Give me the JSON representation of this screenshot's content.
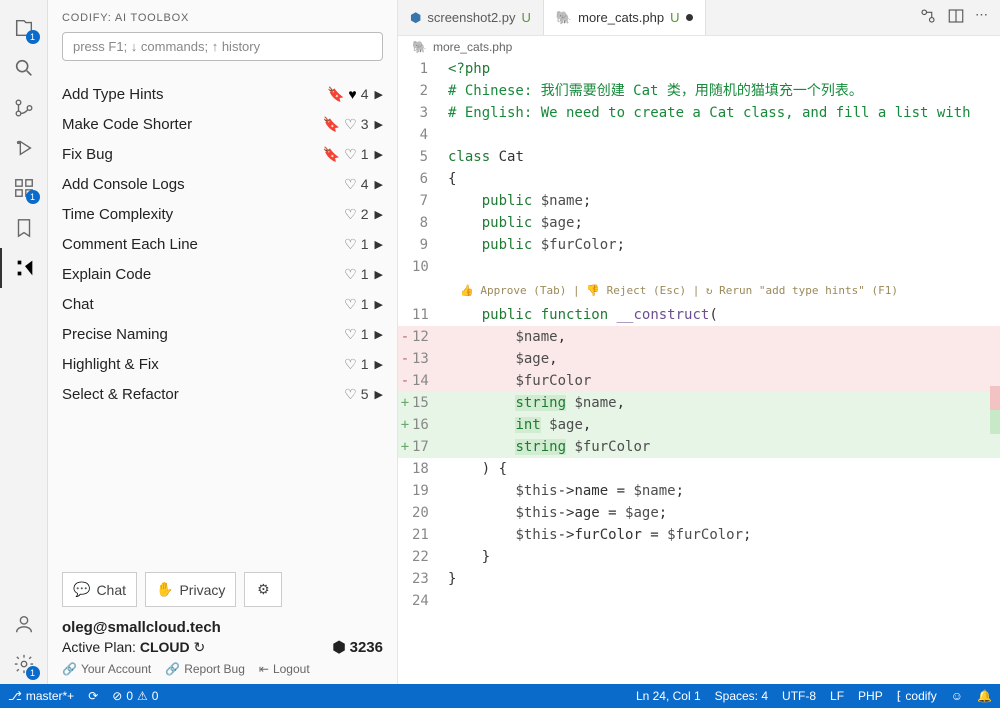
{
  "panel": {
    "title": "CODIFY: AI TOOLBOX",
    "cmd_placeholder": "press F1; ↓ commands; ↑ history"
  },
  "tools": [
    {
      "label": "Add Type Hints",
      "bookmark": true,
      "heart_filled": true,
      "count": 4
    },
    {
      "label": "Make Code Shorter",
      "bookmark": true,
      "heart_filled": false,
      "count": 3
    },
    {
      "label": "Fix Bug",
      "bookmark": true,
      "heart_filled": false,
      "count": 1
    },
    {
      "label": "Add Console Logs",
      "bookmark": false,
      "heart_filled": false,
      "count": 4
    },
    {
      "label": "Time Complexity",
      "bookmark": false,
      "heart_filled": false,
      "count": 2
    },
    {
      "label": "Comment Each Line",
      "bookmark": false,
      "heart_filled": false,
      "count": 1
    },
    {
      "label": "Explain Code",
      "bookmark": false,
      "heart_filled": false,
      "count": 1
    },
    {
      "label": "Chat",
      "bookmark": false,
      "heart_filled": false,
      "count": 1
    },
    {
      "label": "Precise Naming",
      "bookmark": false,
      "heart_filled": false,
      "count": 1
    },
    {
      "label": "Highlight & Fix",
      "bookmark": false,
      "heart_filled": false,
      "count": 1
    },
    {
      "label": "Select & Refactor",
      "bookmark": false,
      "heart_filled": false,
      "count": 5
    }
  ],
  "buttons": {
    "chat": "Chat",
    "privacy": "Privacy"
  },
  "account": {
    "email": "oleg@smallcloud.tech",
    "plan_label": "Active Plan: ",
    "plan_value": "CLOUD",
    "credits": "3236",
    "your_account": "Your Account",
    "report_bug": "Report Bug",
    "logout": "Logout"
  },
  "tabs": [
    {
      "icon": "python",
      "label": "screenshot2.py",
      "mod": "U",
      "active": false
    },
    {
      "icon": "php",
      "label": "more_cats.php",
      "mod": "U",
      "active": true,
      "dirty": true
    }
  ],
  "breadcrumb": "more_cats.php",
  "hint": "👍 Approve (Tab) | 👎 Reject (Esc) | ↻ Rerun \"add type hints\" (F1)",
  "code_lines": [
    {
      "n": 1,
      "diff": "",
      "html": "<span class='kw'>&lt;?php</span>"
    },
    {
      "n": 2,
      "diff": "",
      "html": "<span class='cmt'># Chinese: 我们需要创建 Cat 类，用随机的猫填充一个列表。</span>"
    },
    {
      "n": 3,
      "diff": "",
      "html": "<span class='cmt'># English: We need to create a Cat class, and fill a list with</span>"
    },
    {
      "n": 4,
      "diff": "",
      "html": ""
    },
    {
      "n": 5,
      "diff": "",
      "html": "<span class='kw'>class</span> Cat"
    },
    {
      "n": 6,
      "diff": "",
      "html": "{"
    },
    {
      "n": 7,
      "diff": "",
      "html": "    <span class='kw'>public</span> <span class='var'>$name</span>;"
    },
    {
      "n": 8,
      "diff": "",
      "html": "    <span class='kw'>public</span> <span class='var'>$age</span>;"
    },
    {
      "n": 9,
      "diff": "",
      "html": "    <span class='kw'>public</span> <span class='var'>$furColor</span>;"
    },
    {
      "n": 10,
      "diff": "",
      "html": ""
    },
    {
      "n": 11,
      "diff": "",
      "hint_above": true,
      "html": "    <span class='kw'>public</span> <span class='kw'>function</span> <span class='fn'>__construct</span>("
    },
    {
      "n": 12,
      "diff": "-",
      "cls": "removed",
      "html": "        <span class='var'>$name</span>,"
    },
    {
      "n": 13,
      "diff": "-",
      "cls": "removed",
      "html": "        <span class='var'>$age</span>,"
    },
    {
      "n": 14,
      "diff": "-",
      "cls": "removed",
      "html": "        <span class='var'>$furColor</span>"
    },
    {
      "n": 15,
      "diff": "+",
      "cls": "added",
      "html": "        <span class='hl'><span class='kw'>string</span></span> <span class='var'>$name</span>,"
    },
    {
      "n": 16,
      "diff": "+",
      "cls": "added",
      "html": "        <span class='hl'><span class='kw'>int</span></span> <span class='var'>$age</span>,"
    },
    {
      "n": 17,
      "diff": "+",
      "cls": "added",
      "html": "        <span class='hl'><span class='kw'>string</span></span> <span class='var'>$furColor</span>"
    },
    {
      "n": 18,
      "diff": "",
      "html": "    ) {"
    },
    {
      "n": 19,
      "diff": "",
      "html": "        <span class='var'>$this</span>-&gt;name = <span class='var'>$name</span>;"
    },
    {
      "n": 20,
      "diff": "",
      "html": "        <span class='var'>$this</span>-&gt;age = <span class='var'>$age</span>;"
    },
    {
      "n": 21,
      "diff": "",
      "html": "        <span class='var'>$this</span>-&gt;furColor = <span class='var'>$furColor</span>;"
    },
    {
      "n": 22,
      "diff": "",
      "html": "    }"
    },
    {
      "n": 23,
      "diff": "",
      "html": "}"
    },
    {
      "n": 24,
      "diff": "",
      "html": ""
    }
  ],
  "status": {
    "branch": "master*+",
    "errors": "0",
    "warnings": "0",
    "ln_col": "Ln 24, Col 1",
    "spaces": "Spaces: 4",
    "encoding": "UTF-8",
    "eol": "LF",
    "lang": "PHP",
    "codify": "codify"
  },
  "activity_badges": {
    "files": "1",
    "ext": "1",
    "settings": "1"
  }
}
